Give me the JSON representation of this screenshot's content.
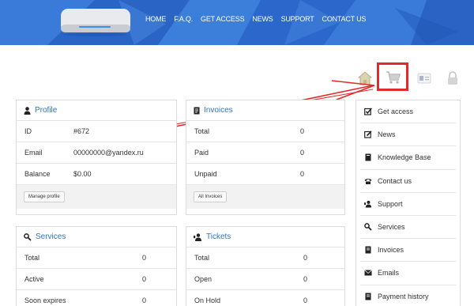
{
  "nav": {
    "items": [
      "HOME",
      "F.A.Q.",
      "GET ACCESS",
      "NEWS",
      "SUPPORT",
      "CONTACT US"
    ]
  },
  "profile": {
    "title": "Profile",
    "rows": [
      {
        "label": "ID",
        "value": "#672"
      },
      {
        "label": "Email",
        "value": "00000000@yandex.ru"
      },
      {
        "label": "Balance",
        "value": "$0.00"
      }
    ],
    "button": "Manage profile"
  },
  "invoices": {
    "title": "Invoices",
    "rows": [
      {
        "label": "Total",
        "value": "0"
      },
      {
        "label": "Paid",
        "value": "0"
      },
      {
        "label": "Unpaid",
        "value": "0"
      }
    ],
    "button": "All Invoices"
  },
  "services": {
    "title": "Services",
    "rows": [
      {
        "label": "Total",
        "value": "0"
      },
      {
        "label": "Active",
        "value": "0"
      },
      {
        "label": "Soon expires",
        "value": "0"
      }
    ]
  },
  "tickets": {
    "title": "Tickets",
    "rows": [
      {
        "label": "Total",
        "value": "0"
      },
      {
        "label": "Open",
        "value": "0"
      },
      {
        "label": "On Hold",
        "value": "0"
      }
    ]
  },
  "sidebar": {
    "items": [
      {
        "label": "Get access",
        "icon": "checkbox-icon"
      },
      {
        "label": "News",
        "icon": "edit-icon"
      },
      {
        "label": "Knowledge Base",
        "icon": "book-icon"
      },
      {
        "label": "Contact us",
        "icon": "phone-icon"
      },
      {
        "label": "Support",
        "icon": "support-icon"
      },
      {
        "label": "Services",
        "icon": "services-icon"
      },
      {
        "label": "Invoices",
        "icon": "invoice-icon"
      },
      {
        "label": "Emails",
        "icon": "envelope-icon"
      },
      {
        "label": "Payment history",
        "icon": "payment-icon"
      }
    ]
  },
  "colors": {
    "brand_blue": "#2f6fd2",
    "link_blue": "#2f74c9",
    "highlight_red": "#e32a2a"
  }
}
